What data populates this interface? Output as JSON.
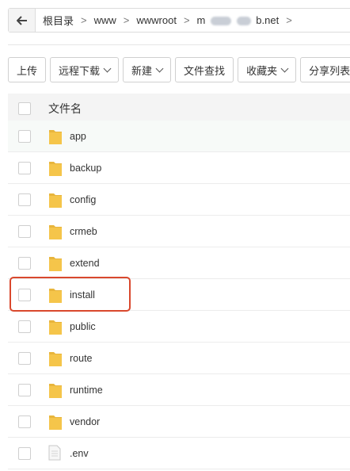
{
  "breadcrumb": {
    "items": [
      "根目录",
      "www",
      "wwwroot"
    ],
    "current_prefix": "m",
    "current_suffix": "b.net"
  },
  "toolbar": {
    "upload": "上传",
    "remote_download": "远程下载",
    "new": "新建",
    "find": "文件查找",
    "favorites": "收藏夹",
    "share_list": "分享列表"
  },
  "table": {
    "header": "文件名",
    "files": [
      {
        "name": "app",
        "type": "folder"
      },
      {
        "name": "backup",
        "type": "folder"
      },
      {
        "name": "config",
        "type": "folder"
      },
      {
        "name": "crmeb",
        "type": "folder"
      },
      {
        "name": "extend",
        "type": "folder"
      },
      {
        "name": "install",
        "type": "folder"
      },
      {
        "name": "public",
        "type": "folder"
      },
      {
        "name": "route",
        "type": "folder"
      },
      {
        "name": "runtime",
        "type": "folder"
      },
      {
        "name": "vendor",
        "type": "folder"
      },
      {
        "name": ".env",
        "type": "file"
      }
    ]
  },
  "colors": {
    "highlight_border": "#d9482d",
    "folder": "#f5c54a"
  }
}
